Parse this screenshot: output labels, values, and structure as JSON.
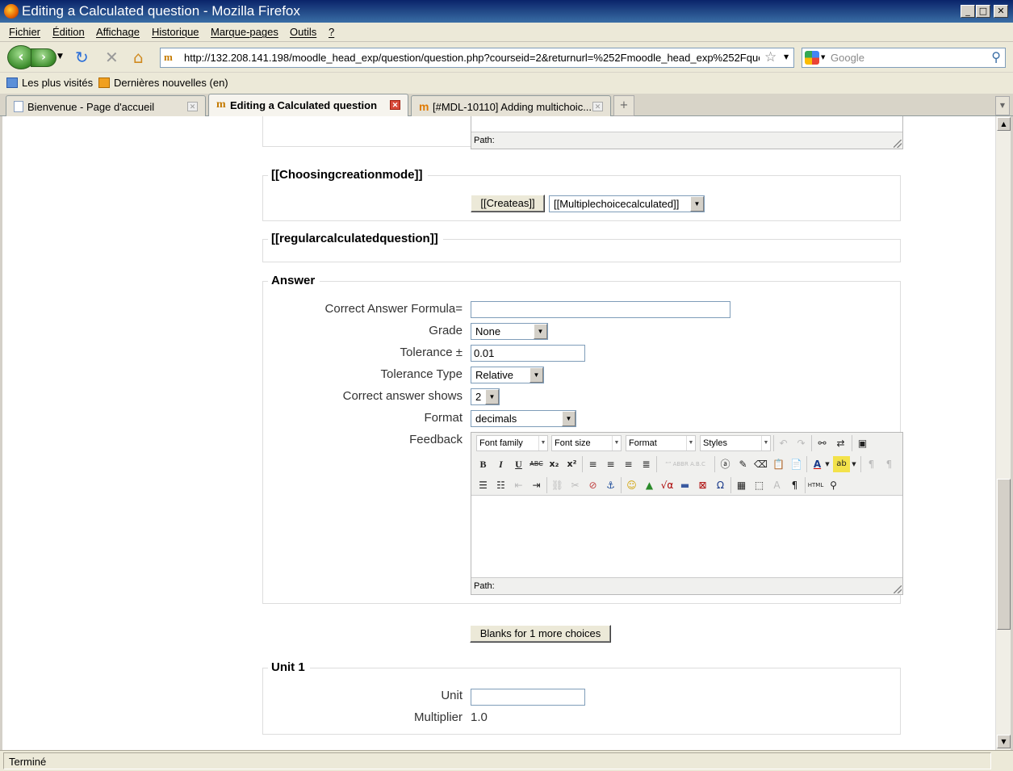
{
  "window": {
    "title": "Editing a Calculated question - Mozilla Firefox",
    "minimize": "_",
    "maximize": "□",
    "close": "✕"
  },
  "menu": [
    "Fichier",
    "Édition",
    "Affichage",
    "Historique",
    "Marque-pages",
    "Outils",
    "?"
  ],
  "nav": {
    "url": "http://132.208.141.198/moodle_head_exp/question/question.php?courseid=2&returnurl=%252Fmoodle_head_exp%252Fque",
    "search_placeholder": "Google"
  },
  "bookmarks": [
    "Les plus visités",
    "Dernières nouvelles (en)"
  ],
  "tabs": [
    {
      "label": "Bienvenue - Page d'accueil"
    },
    {
      "label": "Editing a Calculated question"
    },
    {
      "label": "[#MDL-10110] Adding multichoic..."
    }
  ],
  "top_editor": {
    "path_label": "Path:"
  },
  "choosing_mode": {
    "legend": "[[Choosingcreationmode]]",
    "create_button": "[[Createas]]",
    "select_value": "[[Multiplechoicecalculated]]"
  },
  "regular": {
    "legend": "[[regularcalculatedquestion]]"
  },
  "answer": {
    "legend": "Answer",
    "formula_label": "Correct Answer Formula=",
    "formula_value": "",
    "grade_label": "Grade",
    "grade_value": "None",
    "tolerance_label": "Tolerance ±",
    "tolerance_value": "0.01",
    "tolerance_type_label": "Tolerance Type",
    "tolerance_type_value": "Relative",
    "shows_label": "Correct answer shows",
    "shows_value": "2",
    "format_label": "Format",
    "format_value": "decimals",
    "feedback_label": "Feedback",
    "editor": {
      "font_family": "Font family",
      "font_size": "Font size",
      "format": "Format",
      "styles": "Styles",
      "path_label": "Path:"
    }
  },
  "blanks_button": "Blanks for 1 more choices",
  "unit": {
    "legend": "Unit 1",
    "unit_label": "Unit",
    "unit_value": "",
    "multiplier_label": "Multiplier",
    "multiplier_value": "1.0"
  },
  "status": "Terminé"
}
